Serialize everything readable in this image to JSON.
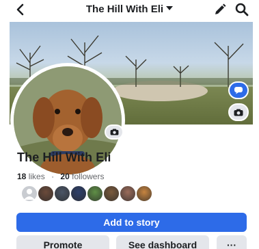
{
  "header": {
    "title": "The Hill With Eli"
  },
  "profile": {
    "name": "The Hill With Eli",
    "likes_count": "18",
    "likes_label": "likes",
    "followers_count": "20",
    "followers_label": "followers",
    "separator": "·"
  },
  "follower_avatars": [
    {
      "color": "#c9ccd1",
      "kind": "default"
    },
    {
      "color": "#6b4a3a"
    },
    {
      "color": "#4a5566"
    },
    {
      "color": "#2d3f6b"
    },
    {
      "color": "#5f8f46"
    },
    {
      "color": "#7a5a3c"
    },
    {
      "color": "#9a6b5a"
    },
    {
      "color": "#c7843f"
    }
  ],
  "actions": {
    "add_to_story": "Add to story",
    "promote": "Promote",
    "see_dashboard": "See dashboard",
    "more": "···"
  },
  "colors": {
    "primary": "#2d6be8",
    "secondary_bg": "#e4e6eb",
    "text": "#1c1e21",
    "muted": "#65676b"
  }
}
